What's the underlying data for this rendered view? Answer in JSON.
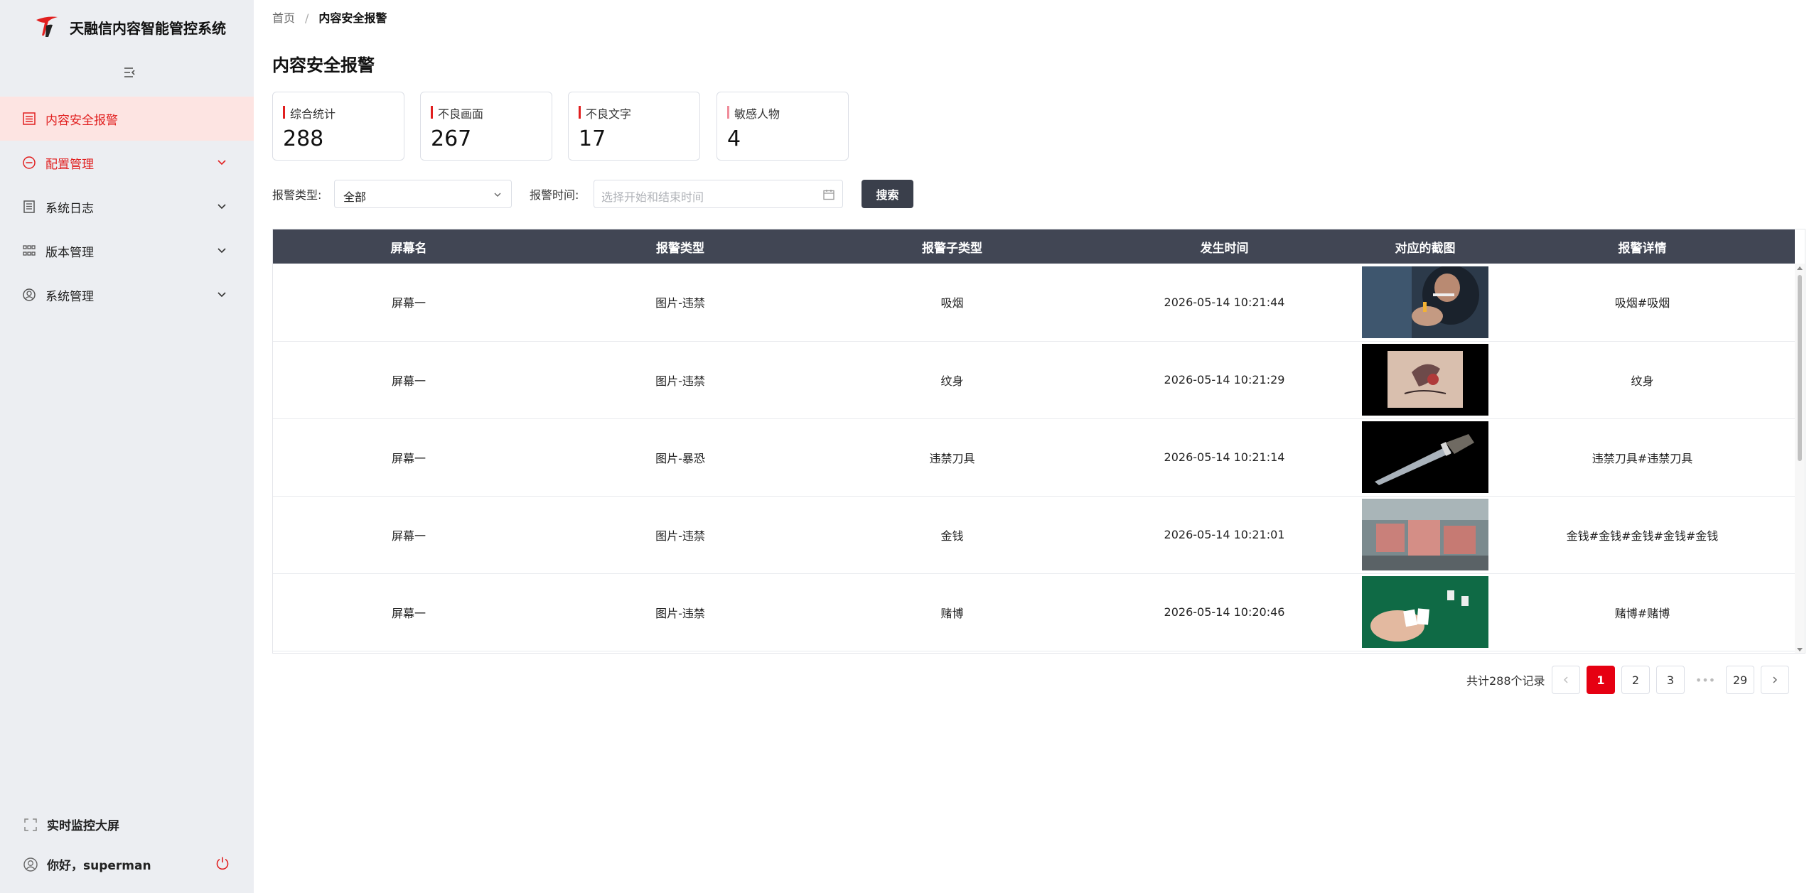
{
  "app": {
    "title": "天融信内容智能管控系统"
  },
  "sidebar": {
    "items": [
      {
        "label": "内容安全报警",
        "active": true
      },
      {
        "label": "配置管理"
      },
      {
        "label": "系统日志"
      },
      {
        "label": "版本管理"
      },
      {
        "label": "系统管理"
      }
    ],
    "monitor_label": "实时监控大屏",
    "user_greeting": "你好，superman"
  },
  "breadcrumb": {
    "home": "首页",
    "separator": "/",
    "current": "内容安全报警"
  },
  "page": {
    "title": "内容安全报警"
  },
  "stats": [
    {
      "label": "综合统计",
      "value": "288"
    },
    {
      "label": "不良画面",
      "value": "267"
    },
    {
      "label": "不良文字",
      "value": "17"
    },
    {
      "label": "敏感人物",
      "value": "4"
    }
  ],
  "filters": {
    "type_label": "报警类型:",
    "type_value": "全部",
    "time_label": "报警时间:",
    "time_placeholder": "选择开始和结束时间",
    "search_label": "搜索"
  },
  "table": {
    "columns": [
      "屏幕名",
      "报警类型",
      "报警子类型",
      "发生时间",
      "对应的截图",
      "报警详情"
    ],
    "rows": [
      {
        "screen": "屏幕一",
        "type": "图片-违禁",
        "subtype": "吸烟",
        "time": "2026-05-14 10:21:44",
        "thumb": "smoking",
        "detail": "吸烟#吸烟"
      },
      {
        "screen": "屏幕一",
        "type": "图片-违禁",
        "subtype": "纹身",
        "time": "2026-05-14 10:21:29",
        "thumb": "tattoo",
        "detail": "纹身"
      },
      {
        "screen": "屏幕一",
        "type": "图片-暴恐",
        "subtype": "违禁刀具",
        "time": "2026-05-14 10:21:14",
        "thumb": "knife",
        "detail": "违禁刀具#违禁刀具"
      },
      {
        "screen": "屏幕一",
        "type": "图片-违禁",
        "subtype": "金钱",
        "time": "2026-05-14 10:21:01",
        "thumb": "money",
        "detail": "金钱#金钱#金钱#金钱#金钱"
      },
      {
        "screen": "屏幕一",
        "type": "图片-违禁",
        "subtype": "赌博",
        "time": "2026-05-14 10:20:46",
        "thumb": "gambling",
        "detail": "赌博#赌博"
      }
    ]
  },
  "pagination": {
    "total_text": "共计288个记录",
    "pages": [
      "1",
      "2",
      "3",
      "•••",
      "29"
    ],
    "current": "1"
  },
  "colors": {
    "accent": "#e11f1f",
    "header_dark": "#414654",
    "button_dark": "#3a3f4b",
    "sidebar_bg": "#eceef2"
  }
}
